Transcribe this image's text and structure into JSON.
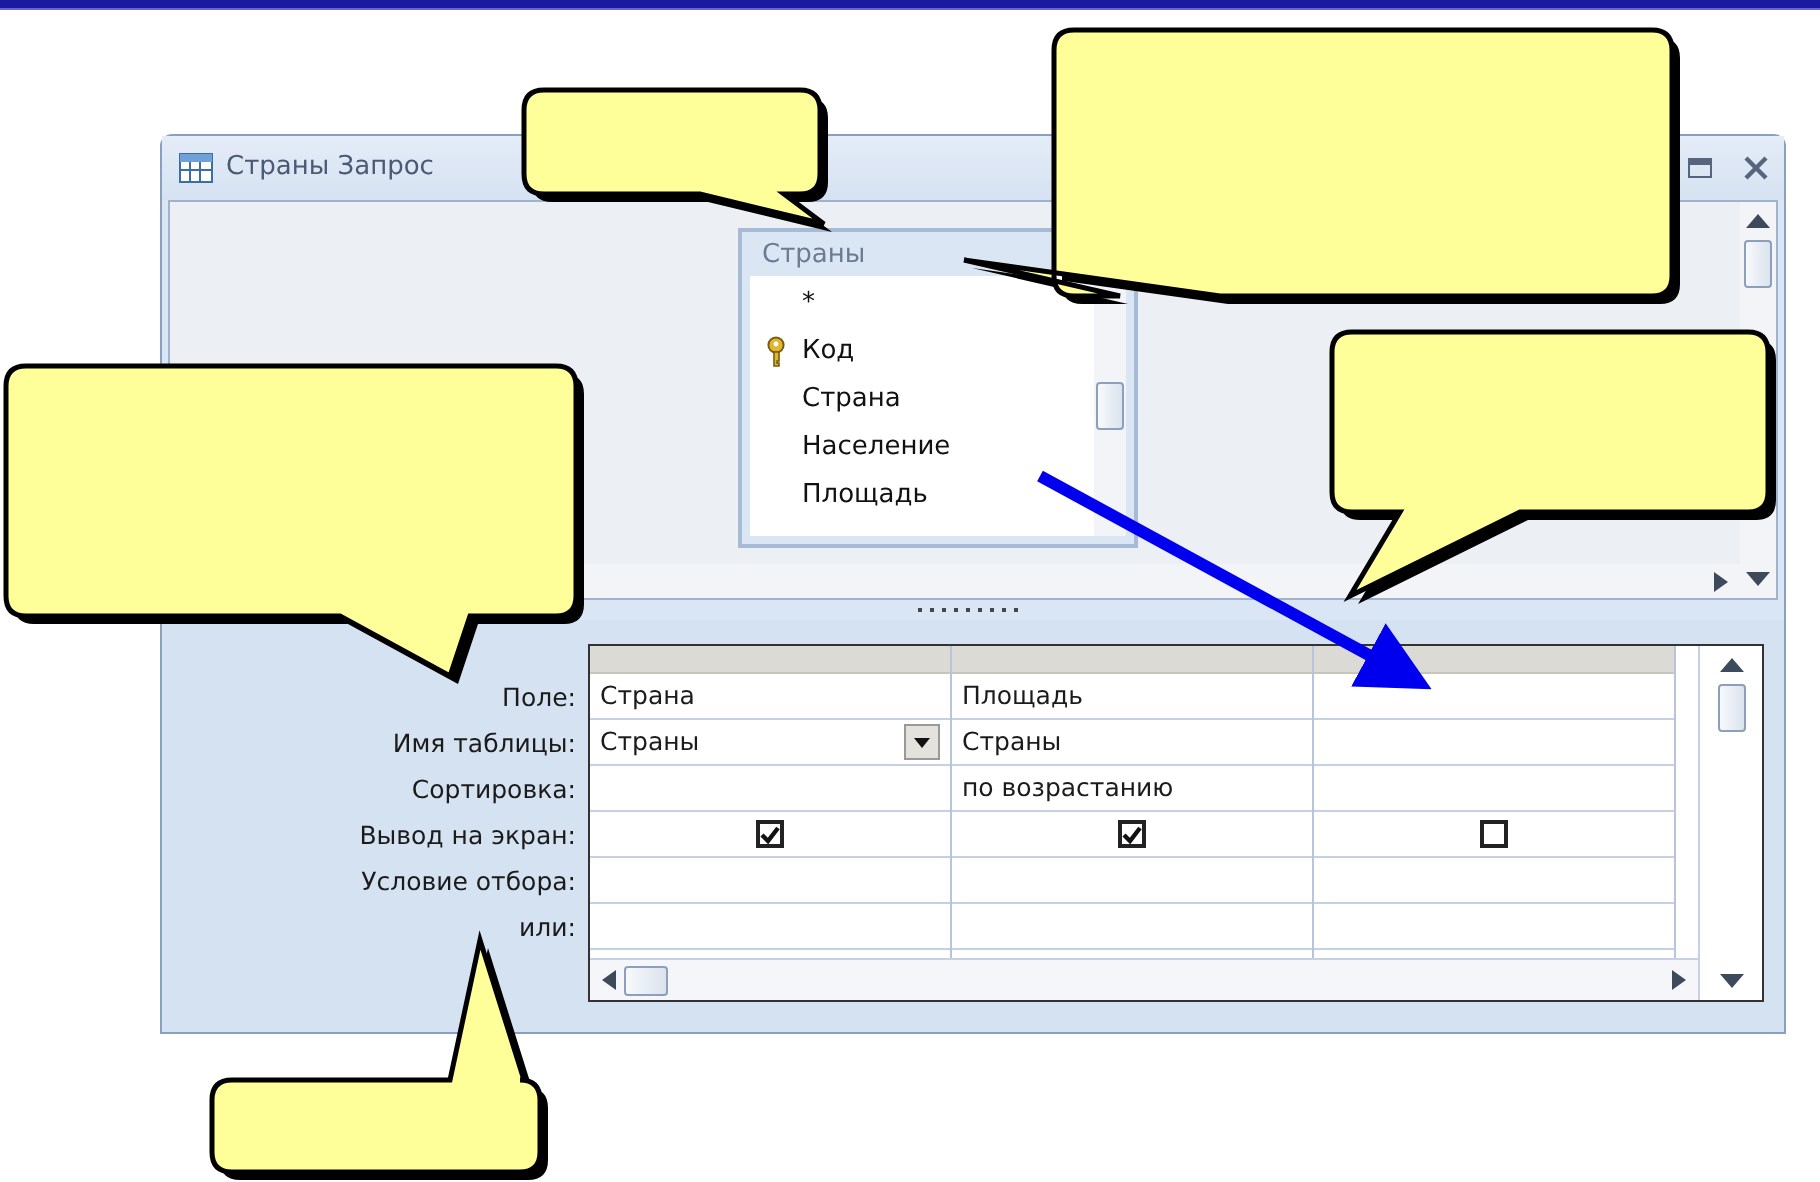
{
  "window": {
    "title": "Страны Запрос"
  },
  "field_list": {
    "title": "Страны",
    "fields": [
      {
        "name": "*",
        "primary_key": false
      },
      {
        "name": "Код",
        "primary_key": true
      },
      {
        "name": "Страна",
        "primary_key": false
      },
      {
        "name": "Население",
        "primary_key": false
      },
      {
        "name": "Площадь",
        "primary_key": false
      }
    ]
  },
  "grid": {
    "row_labels": [
      "Поле:",
      "Имя таблицы:",
      "Сортировка:",
      "Вывод на экран:",
      "Условие отбора:",
      "или:"
    ],
    "columns": [
      {
        "field": "Страна",
        "table": "Страны",
        "show": true,
        "selected": true
      },
      {
        "field": "Площадь",
        "table": "Страны",
        "sort": "по возрастанию",
        "show": true,
        "selected": false
      },
      {
        "show": false,
        "selected": false
      }
    ]
  }
}
